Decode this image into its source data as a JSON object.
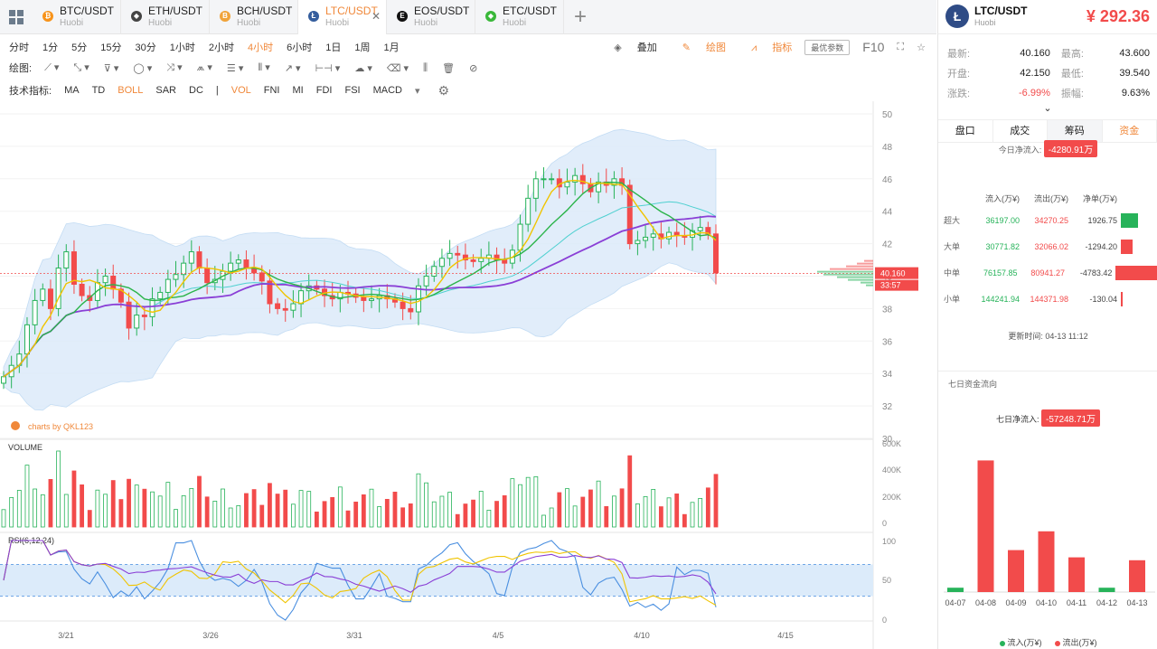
{
  "tabs": [
    {
      "symbol": "BTC/USDT",
      "exchange": "Huobi",
      "coin_glyph": "₿",
      "coin_color": "#f7931a",
      "active": false
    },
    {
      "symbol": "ETH/USDT",
      "exchange": "Huobi",
      "coin_glyph": "◆",
      "coin_color": "#444444",
      "active": false
    },
    {
      "symbol": "BCH/USDT",
      "exchange": "Huobi",
      "coin_glyph": "B",
      "coin_color": "#f0a33a",
      "active": false
    },
    {
      "symbol": "LTC/USDT",
      "exchange": "Huobi",
      "coin_glyph": "Ł",
      "coin_color": "#345d9d",
      "active": true
    },
    {
      "symbol": "EOS/USDT",
      "exchange": "Huobi",
      "coin_glyph": "E",
      "coin_color": "#111111",
      "active": false
    },
    {
      "symbol": "ETC/USDT",
      "exchange": "Huobi",
      "coin_glyph": "◆",
      "coin_color": "#3ab83a",
      "active": false
    }
  ],
  "timeframes": [
    "分时",
    "1分",
    "5分",
    "15分",
    "30分",
    "1小时",
    "2小时",
    "4小时",
    "6小时",
    "1日",
    "1周",
    "1月"
  ],
  "active_timeframe": "4小时",
  "toolbar_right": {
    "overlay": "叠加",
    "draw": "绘图",
    "indicator": "指标",
    "best_params": "最优参数",
    "f10": "F10"
  },
  "draw_label": "绘图:",
  "ind_label": "技术指标:",
  "indicators": [
    "MA",
    "TD",
    "BOLL",
    "SAR",
    "DC",
    "VOL",
    "FNI",
    "MI",
    "FDI",
    "FSI",
    "MACD"
  ],
  "active_indicators": [
    "BOLL",
    "VOL"
  ],
  "chart": {
    "price_ticks": [
      50,
      48,
      46,
      44,
      42,
      40,
      38,
      36,
      34,
      32,
      30
    ],
    "volume_label": "VOLUME",
    "volume_ticks": [
      "600K",
      "400K",
      "200K",
      "0"
    ],
    "rsi_label": "RSI(6,12,24)",
    "rsi_ticks": [
      100,
      50,
      0
    ],
    "date_ticks": [
      "3/21",
      "3/26",
      "3/31",
      "4/5",
      "4/10",
      "4/15"
    ],
    "last_price": "40.160",
    "countdown": "33:57",
    "watermark": "charts by QKL123",
    "colors": {
      "up": "#27b35a",
      "down": "#f24b4b",
      "boll_fill": "#dcebfa",
      "ma_purple": "#8a3fd6",
      "ma_yellow": "#f0c400",
      "ma_green": "#2bb44a",
      "ma_cyan": "#4fd0d0"
    }
  },
  "chart_data": {
    "type": "candlestick",
    "xlabel": "",
    "ylabel": "",
    "ylim": [
      30,
      50
    ],
    "closes": [
      33.8,
      34.5,
      35.2,
      37.0,
      38.5,
      39.2,
      38.0,
      40.5,
      41.5,
      39.5,
      38.8,
      38.5,
      39.6,
      40.0,
      39.2,
      38.4,
      36.8,
      37.6,
      37.5,
      38.6,
      39.0,
      39.8,
      40.1,
      40.8,
      41.5,
      40.5,
      39.6,
      39.8,
      40.3,
      40.8,
      41.0,
      40.5,
      40.2,
      39.7,
      38.3,
      38.0,
      37.9,
      38.3,
      39.1,
      39.4,
      39.2,
      38.8,
      38.6,
      39.0,
      38.9,
      38.7,
      38.5,
      38.6,
      38.8,
      38.6,
      38.4,
      38.0,
      37.8,
      39.4,
      40.0,
      40.6,
      41.1,
      41.4,
      41.3,
      41.0,
      40.9,
      41.1,
      41.3,
      41.0,
      40.8,
      41.6,
      43.2,
      44.8,
      46.0,
      46.0,
      46.0,
      45.5,
      45.8,
      46.2,
      45.7,
      45.2,
      45.8,
      45.6,
      46.0,
      45.6,
      42.0,
      42.2,
      42.4,
      42.6,
      42.3,
      42.7,
      42.5,
      42.4,
      42.8,
      43.0,
      42.6,
      40.2
    ],
    "rsi_range": [
      0,
      100
    ],
    "seven_day_flow": {
      "dates": [
        "04-07",
        "04-08",
        "04-09",
        "04-10",
        "04-11",
        "04-12",
        "04-13"
      ],
      "inflow_signs": [
        "in",
        "out",
        "out",
        "out",
        "out",
        "in",
        "out"
      ],
      "values": [
        3,
        91,
        29,
        42,
        24,
        3,
        22
      ]
    },
    "fund_flow_bars": [
      1926.75,
      -1294.2,
      -4783.42,
      -130.04
    ]
  },
  "right": {
    "symbol": "LTC/USDT",
    "exchange": "Huobi",
    "price": "¥ 292.36",
    "stats": [
      {
        "l1": "最新:",
        "v1": "40.160",
        "l2": "最高:",
        "v2": "43.600",
        "c1": "",
        "c2": ""
      },
      {
        "l1": "开盘:",
        "v1": "42.150",
        "l2": "最低:",
        "v2": "39.540",
        "c1": "",
        "c2": ""
      },
      {
        "l1": "涨跌:",
        "v1": "-6.99%",
        "l2": "振幅:",
        "v2": "9.63%",
        "c1": "red",
        "c2": ""
      }
    ],
    "tabs": [
      "盘口",
      "成交",
      "筹码",
      "资金"
    ],
    "today_label": "今日净流入:",
    "today_value": "-4280.91万",
    "flow_headers": [
      "流入(万¥)",
      "流出(万¥)",
      "净单(万¥)"
    ],
    "flow_rows": [
      {
        "name": "超大",
        "in": "36197.00",
        "out": "34270.25",
        "net": "1926.75",
        "pos": true
      },
      {
        "name": "大单",
        "in": "30771.82",
        "out": "32066.02",
        "net": "-1294.20",
        "pos": false
      },
      {
        "name": "中单",
        "in": "76157.85",
        "out": "80941.27",
        "net": "-4783.42",
        "pos": false
      },
      {
        "name": "小单",
        "in": "144241.94",
        "out": "144371.98",
        "net": "-130.04",
        "pos": false
      }
    ],
    "update_time": "更新时间:  04-13 11:12",
    "seven_title": "七日资金流向",
    "seven_label": "七日净流入:",
    "seven_value": "-57248.71万",
    "legend_in": "流入(万¥)",
    "legend_out": "流出(万¥)"
  }
}
